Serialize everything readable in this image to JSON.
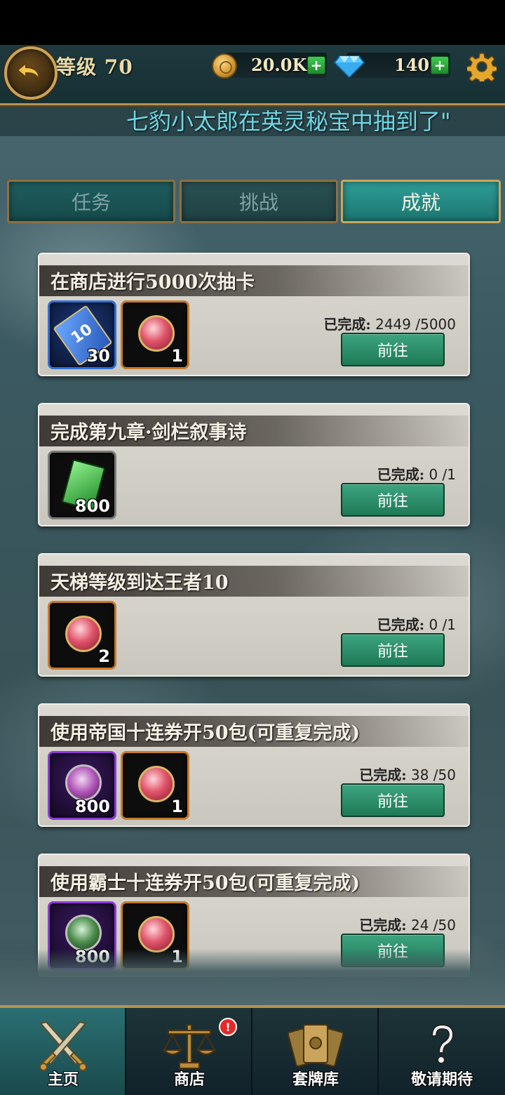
{
  "header": {
    "level_label": "等级 70",
    "gold": "20.0K",
    "gems": "140",
    "plus": "+"
  },
  "marquee": "七豹小太郎在英灵秘宝中抽到了\"",
  "tabs": [
    {
      "label": "任务",
      "active": false
    },
    {
      "label": "挑战",
      "active": false
    },
    {
      "label": "成就",
      "active": true
    }
  ],
  "achievements": [
    {
      "title": "在商店进行5000次抽卡",
      "rewards": [
        {
          "icon": "draw-ticket-icon",
          "count": "30"
        },
        {
          "icon": "ruby-gem-icon",
          "count": "1"
        }
      ],
      "progress_label": "已完成:",
      "progress": "2449 /5000",
      "button": "前往"
    },
    {
      "title": "完成第九章·剑栏叙事诗",
      "rewards": [
        {
          "icon": "card-icon",
          "count": "800"
        }
      ],
      "progress_label": "已完成:",
      "progress": "0 /1",
      "button": "前往"
    },
    {
      "title": "天梯等级到达王者10",
      "rewards": [
        {
          "icon": "ruby-gem-icon",
          "count": "2"
        }
      ],
      "progress_label": "已完成:",
      "progress": "0 /1",
      "button": "前往"
    },
    {
      "title": "使用帝国十连券开50包(可重复完成)",
      "rewards": [
        {
          "icon": "empire-emblem-icon",
          "count": "800"
        },
        {
          "icon": "ruby-gem-icon",
          "count": "1"
        }
      ],
      "progress_label": "已完成:",
      "progress": "38 /50",
      "button": "前往"
    },
    {
      "title": "使用霸士十连券开50包(可重复完成)",
      "rewards": [
        {
          "icon": "overlord-emblem-icon",
          "count": "800"
        },
        {
          "icon": "ruby-gem-icon",
          "count": "1"
        }
      ],
      "progress_label": "已完成:",
      "progress": "24 /50",
      "button": "前往"
    }
  ],
  "ticket_text": "10",
  "bottom_nav": [
    {
      "label": "主页",
      "icon": "crossed-swords-icon"
    },
    {
      "label": "商店",
      "icon": "scales-icon",
      "badge": "!"
    },
    {
      "label": "套牌库",
      "icon": "card-deck-icon"
    },
    {
      "label": "敬请期待",
      "icon": "question-mark-icon"
    }
  ],
  "colors": {
    "accent_gold": "#b69250",
    "button_green": "#1f7a57",
    "tab_active": "#2e9d97",
    "marquee_text": "#6ed8e6"
  }
}
